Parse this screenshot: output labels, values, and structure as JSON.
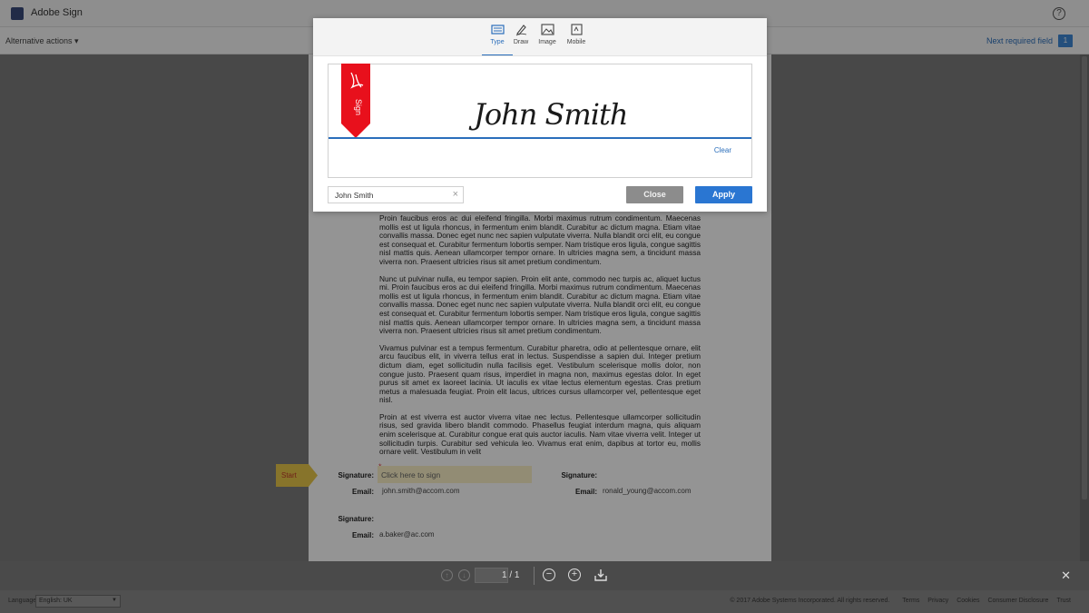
{
  "header": {
    "app_title": "Adobe Sign",
    "help_label": "?",
    "alternative_actions": "Alternative actions ▾",
    "next_required_field": "Next required field",
    "next_required_count": "1"
  },
  "document": {
    "paragraphs": [
      "Proin faucibus eros ac dui eleifend fringilla. Morbi maximus rutrum condimentum. Maecenas mollis est ut ligula rhoncus, in fermentum enim blandit. Curabitur ac dictum magna. Etiam vitae convallis massa. Donec eget nunc nec sapien vulputate viverra. Nulla blandit orci elit, eu congue est consequat et. Curabitur fermentum lobortis semper. Nam tristique eros ligula, congue sagittis nisl mattis quis. Aenean ullamcorper tempor ornare. In ultricies magna sem, a tincidunt massa viverra non. Praesent ultricies risus sit amet pretium condimentum.",
      "Nunc ut pulvinar nulla, eu tempor sapien. Proin elit ante, commodo nec turpis ac, aliquet luctus mi. Proin faucibus eros ac dui eleifend fringilla. Morbi maximus rutrum condimentum. Maecenas mollis est ut ligula rhoncus, in fermentum enim blandit. Curabitur ac dictum magna. Etiam vitae convallis massa. Donec eget nunc nec sapien vulputate viverra. Nulla blandit orci elit, eu congue est consequat et. Curabitur fermentum lobortis semper. Nam tristique eros ligula, congue sagittis nisl mattis quis. Aenean ullamcorper tempor ornare. In ultricies magna sem, a tincidunt massa viverra non. Praesent ultricies risus sit amet pretium condimentum.",
      "Vivamus pulvinar est a tempus fermentum. Curabitur pharetra, odio at pellentesque ornare, elit arcu faucibus elit, in viverra tellus erat in lectus. Suspendisse a sapien dui. Integer pretium dictum diam, eget sollicitudin nulla facilisis eget. Vestibulum scelerisque mollis dolor, non congue justo. Praesent quam risus, imperdiet in magna non, maximus egestas dolor. In eget purus sit amet ex laoreet lacinia. Ut iaculis ex vitae lectus elementum egestas. Cras pretium metus a malesuada feugiat. Proin elit lacus, ultrices cursus ullamcorper vel, pellentesque eget nisl.",
      "Proin at est viverra est auctor viverra vitae nec lectus. Pellentesque ullamcorper sollicitudin risus, sed gravida libero blandit commodo. Phasellus feugiat interdum magna, quis aliquam enim scelerisque at. Curabitur congue erat quis auctor iaculis. Nam vitae viverra velit. Integer ut sollicitudin turpis. Curabitur sed vehicula leo. Vivamus erat enim, dapibus at tortor eu, mollis ornare velit. Vestibulum in velit"
    ],
    "start_label": "Start",
    "signature_label": "Signature:",
    "email_label": "Email:",
    "sig_field_placeholder": "Click here to sign",
    "required_marker": "*",
    "email_1": "john.smith@accom.com",
    "email_2": "ronald_young@accom.com",
    "email_3": "a.baker@ac.com"
  },
  "toolbar": {
    "page_indicator": "1 / 1",
    "prev_icon": "arrow-up-icon",
    "next_icon": "arrow-down-icon",
    "zoom_out": "−",
    "zoom_in": "+",
    "close_symbol": "✕"
  },
  "footer": {
    "language_label": "Language",
    "language_value": "English: UK",
    "copyright": "© 2017 Adobe Systems Incorporated. All rights reserved.",
    "links": [
      "Terms",
      "Privacy",
      "Cookies",
      "Consumer Disclosure",
      "Trust"
    ]
  },
  "modal": {
    "tabs": [
      {
        "label": "Type",
        "icon": "keyboard-icon",
        "active": true
      },
      {
        "label": "Draw",
        "icon": "pen-icon",
        "active": false
      },
      {
        "label": "Image",
        "icon": "image-icon",
        "active": false
      },
      {
        "label": "Mobile",
        "icon": "mobile-icon",
        "active": false
      }
    ],
    "ribbon_text": "Sign",
    "signature_preview": "John Smith",
    "clear_label": "Clear",
    "name_input_value": "John Smith",
    "close_button": "Close",
    "apply_button": "Apply",
    "colors": {
      "accent": "#2a76d2",
      "ribbon": "#e8101c",
      "close_btn": "#8c8c8c"
    }
  }
}
